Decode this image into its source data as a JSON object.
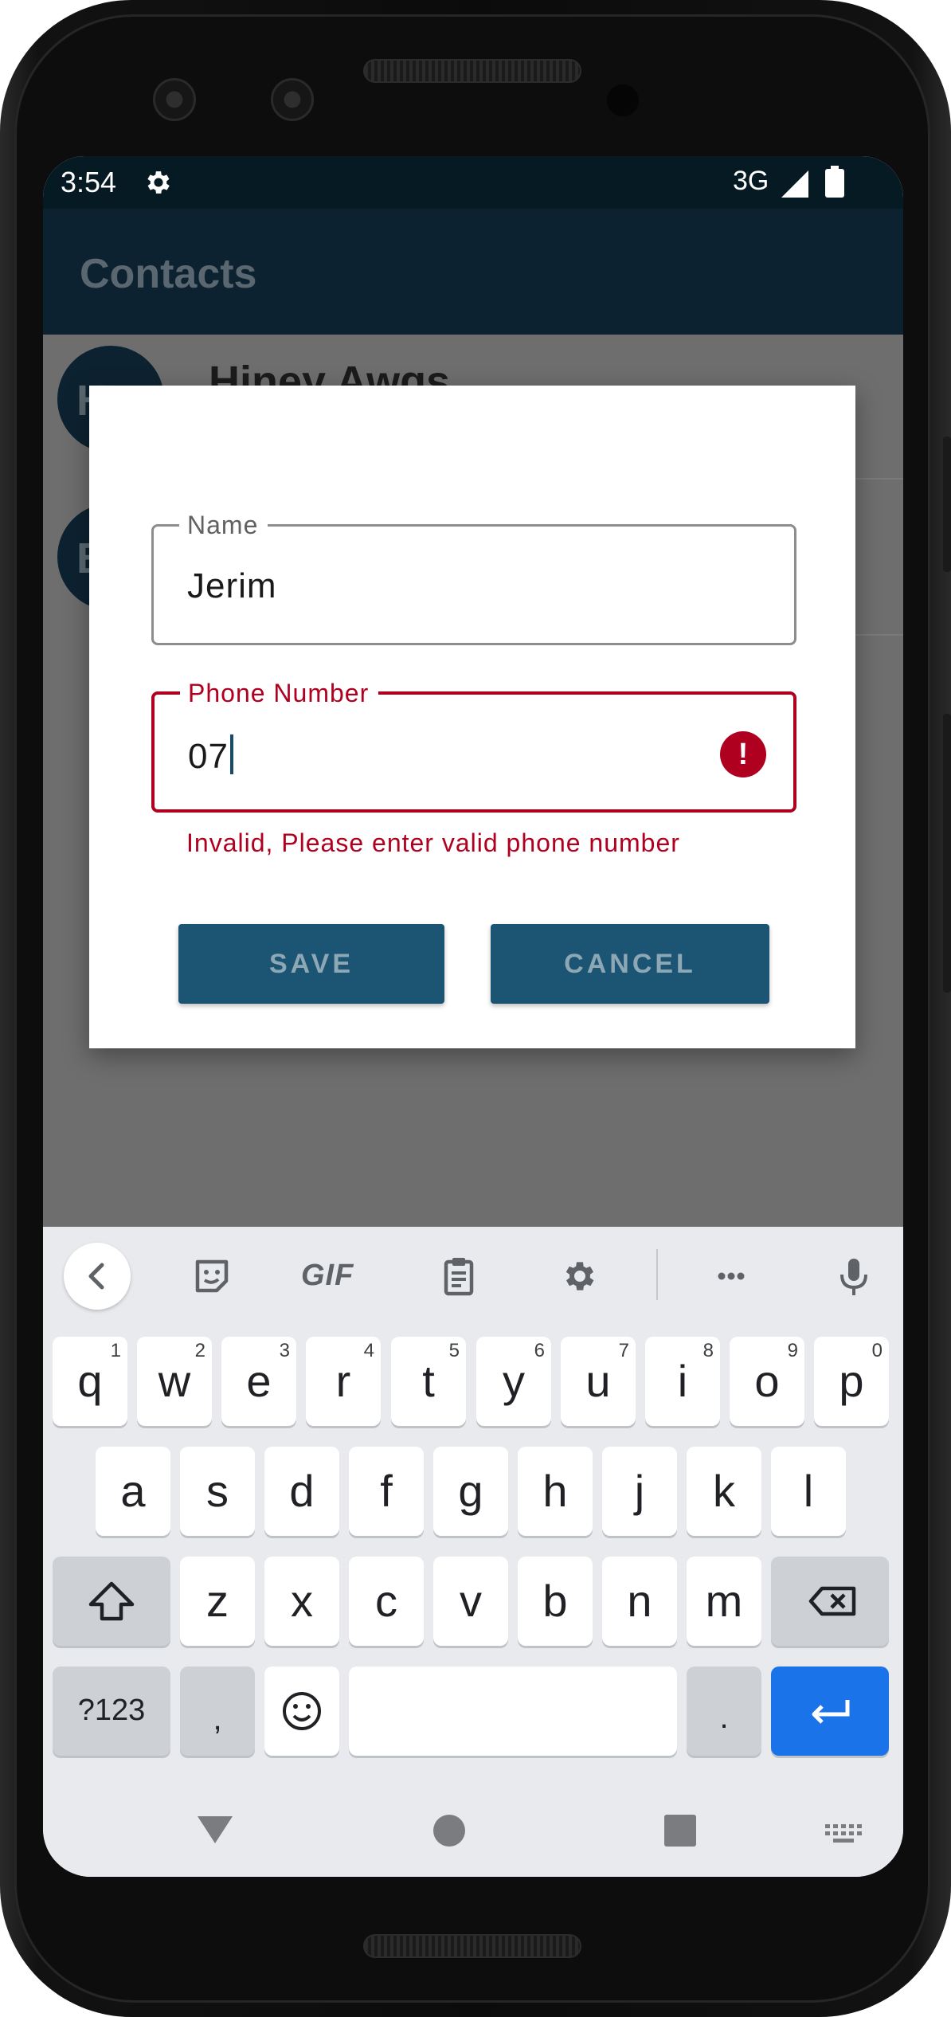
{
  "status_bar": {
    "time": "3:54",
    "network": "3G",
    "icons": [
      "gear-icon",
      "signal-icon",
      "battery-icon"
    ]
  },
  "app_bar": {
    "title": "Contacts"
  },
  "contacts": [
    {
      "initials": "HA",
      "name": "Hiney Awgs"
    },
    {
      "initials": "B",
      "name": ""
    }
  ],
  "dialog": {
    "name_field": {
      "label": "Name",
      "value": "Jerim"
    },
    "phone_field": {
      "label": "Phone Number",
      "value": "07",
      "helper": "Invalid, Please enter valid phone number"
    },
    "save_label": "SAVE",
    "cancel_label": "CANCEL"
  },
  "fab": {
    "icon": "plus-icon"
  },
  "keyboard": {
    "toolbar": {
      "gif_label": "GIF",
      "icons": [
        "back-icon",
        "sticker-icon",
        "clipboard-icon",
        "settings-icon",
        "more-icon",
        "mic-icon"
      ]
    },
    "row1": [
      {
        "label": "q",
        "hint": "1"
      },
      {
        "label": "w",
        "hint": "2"
      },
      {
        "label": "e",
        "hint": "3"
      },
      {
        "label": "r",
        "hint": "4"
      },
      {
        "label": "t",
        "hint": "5"
      },
      {
        "label": "y",
        "hint": "6"
      },
      {
        "label": "u",
        "hint": "7"
      },
      {
        "label": "i",
        "hint": "8"
      },
      {
        "label": "o",
        "hint": "9"
      },
      {
        "label": "p",
        "hint": "0"
      }
    ],
    "row2": [
      "a",
      "s",
      "d",
      "f",
      "g",
      "h",
      "j",
      "k",
      "l"
    ],
    "row3": [
      "z",
      "x",
      "c",
      "v",
      "b",
      "n",
      "m"
    ],
    "row4": {
      "symbols_label": "?123",
      "comma_label": ",",
      "period_label": "."
    }
  },
  "colors": {
    "accent": "#1b5573",
    "error": "#b00020",
    "appbar": "#0d2230",
    "enter_key": "#1a73e8"
  }
}
